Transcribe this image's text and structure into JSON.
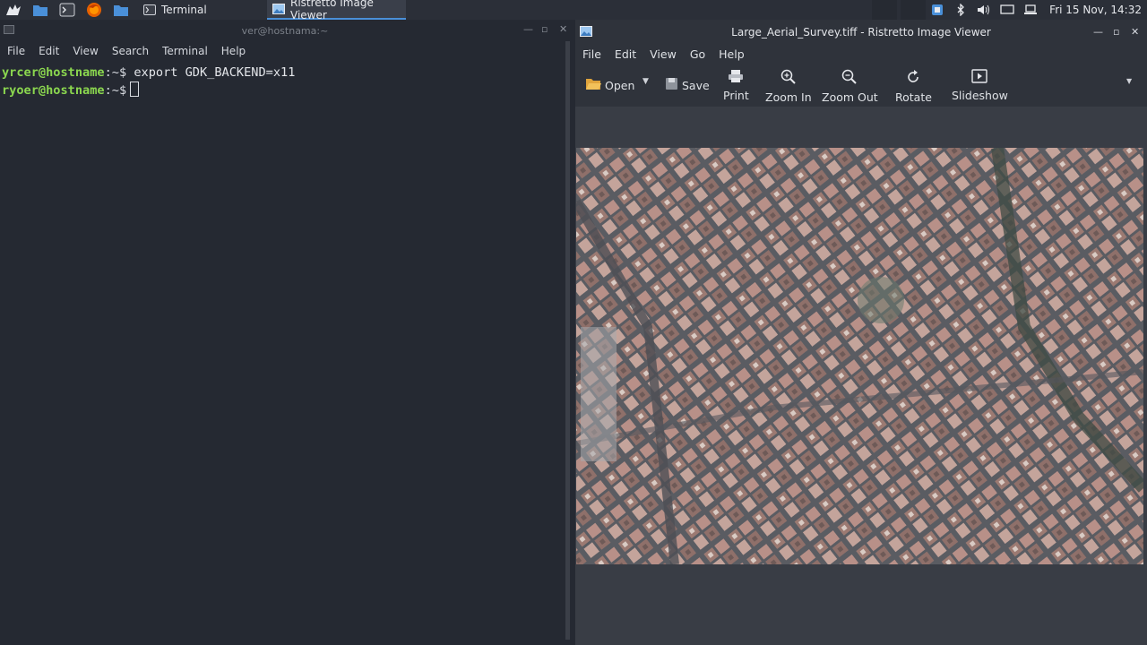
{
  "panel": {
    "tasks": [
      {
        "label": "Terminal"
      },
      {
        "label": "Ristretto Image Viewer"
      }
    ],
    "clock": "Fri 15 Nov, 14:32"
  },
  "terminal": {
    "title": "ver@hostnama:~",
    "menu": [
      "File",
      "Edit",
      "View",
      "Search",
      "Terminal",
      "Help"
    ],
    "lines": [
      {
        "user": "yrcer@hostname",
        "path": ":~$",
        "command": "export GDK_BACKEND=x11"
      },
      {
        "user": "ryoer@hostname",
        "path": ":~$",
        "command": ""
      }
    ]
  },
  "viewer": {
    "title": "Large_Aerial_Survey.tiff - Ristretto Image Viewer",
    "menu": [
      "File",
      "Edit",
      "View",
      "Go",
      "Help"
    ],
    "toolbar": {
      "open": "Open",
      "save": "Save",
      "print": "Print",
      "zoom_in": "Zoom In",
      "zoom_out": "Zoom Out",
      "rotate": "Rotate",
      "slideshow": "Slideshow"
    }
  },
  "colors": {
    "prompt_user": "#8bd74f",
    "panel_bg": "#2b2f38",
    "terminal_bg": "#252932",
    "viewer_bg": "#393d45"
  }
}
